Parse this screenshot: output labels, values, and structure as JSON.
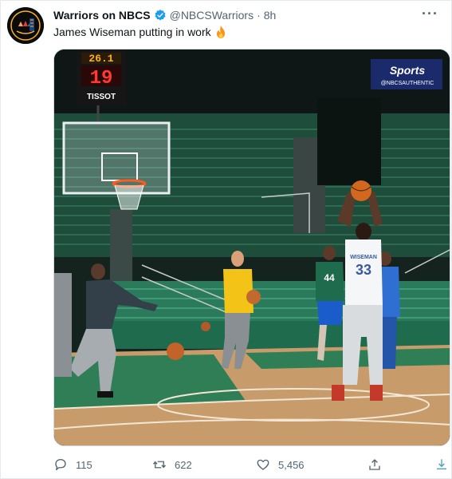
{
  "author": {
    "display_name": "Warriors on NBCS",
    "handle": "@NBCSWarriors",
    "separator": "·",
    "time": "8h",
    "verified_color": "#1d9bf0"
  },
  "tweet_text": "James Wiseman putting in work",
  "media": {
    "shot_clock_top": "26.1",
    "shot_clock_main": "19",
    "scoreboard_brand": "TISSOT",
    "watermark_brand": "Sports",
    "watermark_sub": "@NBCSAUTHENTIC",
    "jersey_name": "WISEMAN",
    "jersey_number": "33",
    "teammate_number": "44"
  },
  "actions": {
    "replies": "115",
    "retweets": "622",
    "likes": "5,456"
  },
  "colors": {
    "secondary_text": "#536471",
    "court_green": "#2f7e56",
    "arena_dark": "#15231f"
  }
}
